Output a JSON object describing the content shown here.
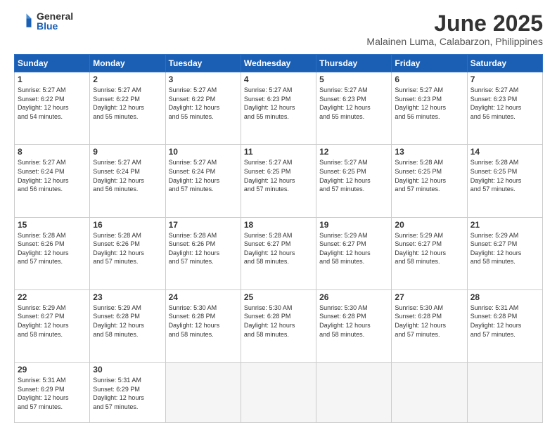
{
  "logo": {
    "general": "General",
    "blue": "Blue"
  },
  "title": "June 2025",
  "subtitle": "Malainen Luma, Calabarzon, Philippines",
  "headers": [
    "Sunday",
    "Monday",
    "Tuesday",
    "Wednesday",
    "Thursday",
    "Friday",
    "Saturday"
  ],
  "weeks": [
    [
      {
        "day": "1",
        "info": "Sunrise: 5:27 AM\nSunset: 6:22 PM\nDaylight: 12 hours\nand 54 minutes."
      },
      {
        "day": "2",
        "info": "Sunrise: 5:27 AM\nSunset: 6:22 PM\nDaylight: 12 hours\nand 55 minutes."
      },
      {
        "day": "3",
        "info": "Sunrise: 5:27 AM\nSunset: 6:22 PM\nDaylight: 12 hours\nand 55 minutes."
      },
      {
        "day": "4",
        "info": "Sunrise: 5:27 AM\nSunset: 6:23 PM\nDaylight: 12 hours\nand 55 minutes."
      },
      {
        "day": "5",
        "info": "Sunrise: 5:27 AM\nSunset: 6:23 PM\nDaylight: 12 hours\nand 55 minutes."
      },
      {
        "day": "6",
        "info": "Sunrise: 5:27 AM\nSunset: 6:23 PM\nDaylight: 12 hours\nand 56 minutes."
      },
      {
        "day": "7",
        "info": "Sunrise: 5:27 AM\nSunset: 6:23 PM\nDaylight: 12 hours\nand 56 minutes."
      }
    ],
    [
      {
        "day": "8",
        "info": "Sunrise: 5:27 AM\nSunset: 6:24 PM\nDaylight: 12 hours\nand 56 minutes."
      },
      {
        "day": "9",
        "info": "Sunrise: 5:27 AM\nSunset: 6:24 PM\nDaylight: 12 hours\nand 56 minutes."
      },
      {
        "day": "10",
        "info": "Sunrise: 5:27 AM\nSunset: 6:24 PM\nDaylight: 12 hours\nand 57 minutes."
      },
      {
        "day": "11",
        "info": "Sunrise: 5:27 AM\nSunset: 6:25 PM\nDaylight: 12 hours\nand 57 minutes."
      },
      {
        "day": "12",
        "info": "Sunrise: 5:27 AM\nSunset: 6:25 PM\nDaylight: 12 hours\nand 57 minutes."
      },
      {
        "day": "13",
        "info": "Sunrise: 5:28 AM\nSunset: 6:25 PM\nDaylight: 12 hours\nand 57 minutes."
      },
      {
        "day": "14",
        "info": "Sunrise: 5:28 AM\nSunset: 6:25 PM\nDaylight: 12 hours\nand 57 minutes."
      }
    ],
    [
      {
        "day": "15",
        "info": "Sunrise: 5:28 AM\nSunset: 6:26 PM\nDaylight: 12 hours\nand 57 minutes."
      },
      {
        "day": "16",
        "info": "Sunrise: 5:28 AM\nSunset: 6:26 PM\nDaylight: 12 hours\nand 57 minutes."
      },
      {
        "day": "17",
        "info": "Sunrise: 5:28 AM\nSunset: 6:26 PM\nDaylight: 12 hours\nand 57 minutes."
      },
      {
        "day": "18",
        "info": "Sunrise: 5:28 AM\nSunset: 6:27 PM\nDaylight: 12 hours\nand 58 minutes."
      },
      {
        "day": "19",
        "info": "Sunrise: 5:29 AM\nSunset: 6:27 PM\nDaylight: 12 hours\nand 58 minutes."
      },
      {
        "day": "20",
        "info": "Sunrise: 5:29 AM\nSunset: 6:27 PM\nDaylight: 12 hours\nand 58 minutes."
      },
      {
        "day": "21",
        "info": "Sunrise: 5:29 AM\nSunset: 6:27 PM\nDaylight: 12 hours\nand 58 minutes."
      }
    ],
    [
      {
        "day": "22",
        "info": "Sunrise: 5:29 AM\nSunset: 6:27 PM\nDaylight: 12 hours\nand 58 minutes."
      },
      {
        "day": "23",
        "info": "Sunrise: 5:29 AM\nSunset: 6:28 PM\nDaylight: 12 hours\nand 58 minutes."
      },
      {
        "day": "24",
        "info": "Sunrise: 5:30 AM\nSunset: 6:28 PM\nDaylight: 12 hours\nand 58 minutes."
      },
      {
        "day": "25",
        "info": "Sunrise: 5:30 AM\nSunset: 6:28 PM\nDaylight: 12 hours\nand 58 minutes."
      },
      {
        "day": "26",
        "info": "Sunrise: 5:30 AM\nSunset: 6:28 PM\nDaylight: 12 hours\nand 58 minutes."
      },
      {
        "day": "27",
        "info": "Sunrise: 5:30 AM\nSunset: 6:28 PM\nDaylight: 12 hours\nand 57 minutes."
      },
      {
        "day": "28",
        "info": "Sunrise: 5:31 AM\nSunset: 6:28 PM\nDaylight: 12 hours\nand 57 minutes."
      }
    ],
    [
      {
        "day": "29",
        "info": "Sunrise: 5:31 AM\nSunset: 6:29 PM\nDaylight: 12 hours\nand 57 minutes."
      },
      {
        "day": "30",
        "info": "Sunrise: 5:31 AM\nSunset: 6:29 PM\nDaylight: 12 hours\nand 57 minutes."
      },
      {
        "day": "",
        "info": ""
      },
      {
        "day": "",
        "info": ""
      },
      {
        "day": "",
        "info": ""
      },
      {
        "day": "",
        "info": ""
      },
      {
        "day": "",
        "info": ""
      }
    ]
  ]
}
